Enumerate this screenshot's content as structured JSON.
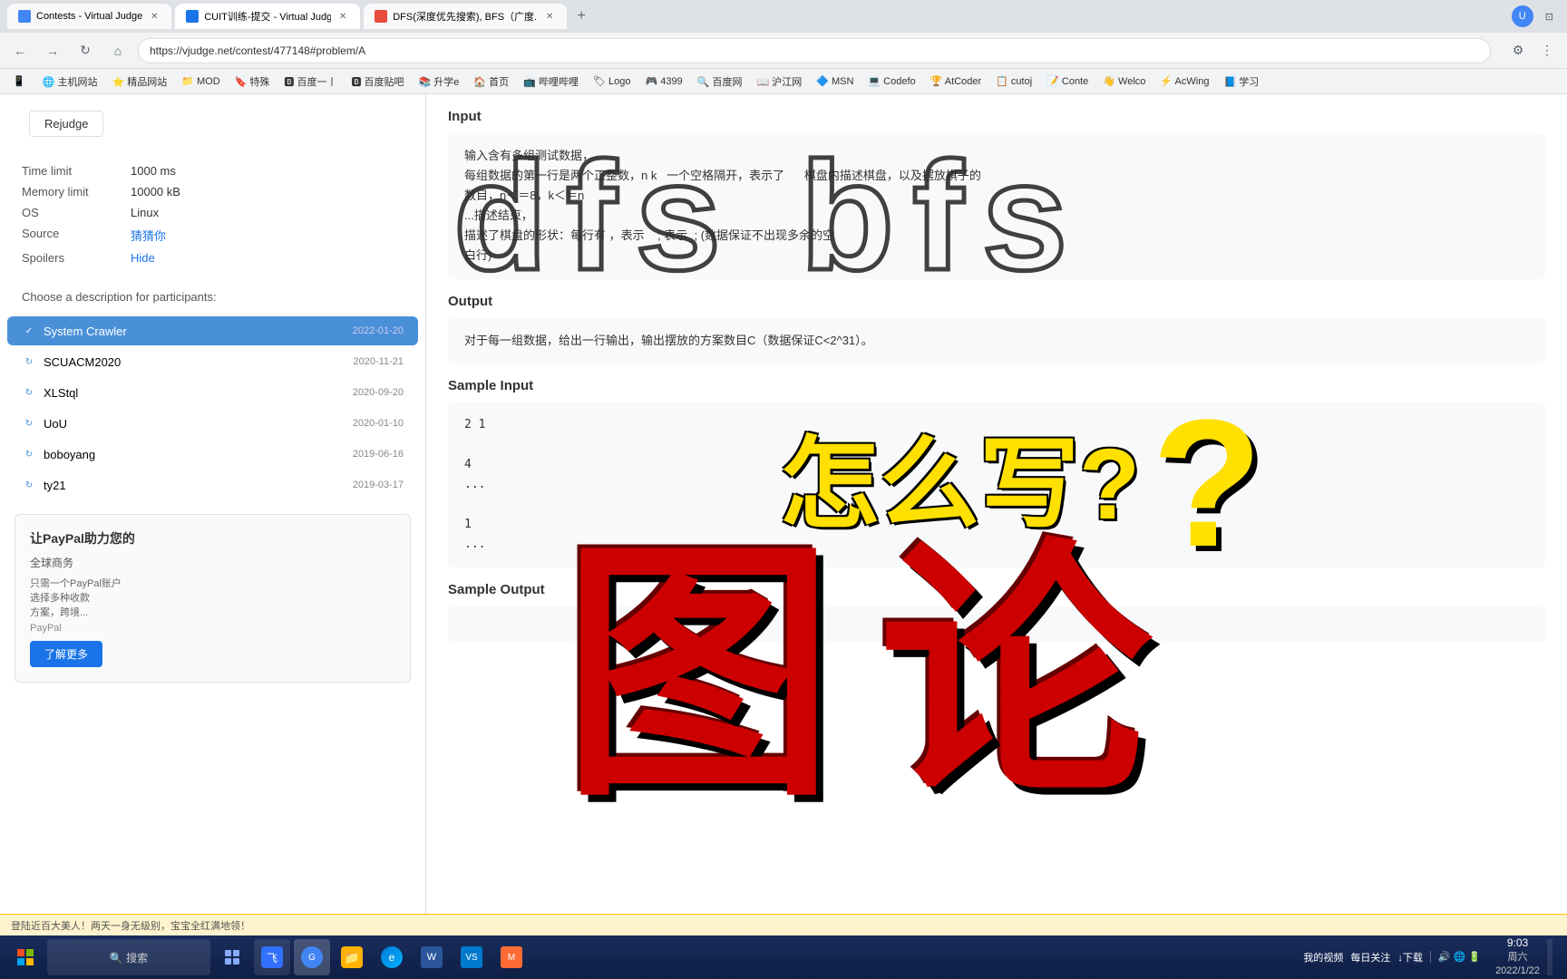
{
  "browser": {
    "tabs": [
      {
        "id": "tab1",
        "label": "Contests - Virtual Judge",
        "favicon_color": "#4285f4",
        "active": false
      },
      {
        "id": "tab2",
        "label": "CUIT训练-提交 - Virtual Judge",
        "favicon_color": "#1a73e8",
        "active": true
      },
      {
        "id": "tab3",
        "label": "DFS(深度优先搜索), BFS（广度...",
        "favicon_color": "#e74c3c",
        "active": false
      }
    ],
    "address": "https://vjudge.net/contest/477148#problem/A",
    "nav_buttons": [
      "←",
      "→",
      "↻",
      "⌂"
    ]
  },
  "bookmarks": [
    "手机收藏夹",
    "主机网站",
    "精品网站",
    "MOD",
    "特殊",
    "百度一丨",
    "百度贴吧",
    "升学e",
    "首页",
    "哔哩哔哩",
    "Logo",
    "4399",
    "百度网",
    "沪江网",
    "MSN",
    "Codefo",
    "AtCoder",
    "cutoj",
    "Conte",
    "Welco",
    "AcWing",
    "学习"
  ],
  "sidebar": {
    "rejudge_btn": "Rejudge",
    "problem_meta": {
      "time_limit_label": "Time limit",
      "time_limit_value": "1000 ms",
      "memory_limit_label": "Memory limit",
      "memory_limit_value": "10000 kB",
      "os_label": "OS",
      "os_value": "Linux",
      "source_label": "Source",
      "source_value": "猜猜你",
      "spoilers_label": "Spoilers",
      "spoilers_value": "Hide"
    },
    "choose_desc": "Choose a description for participants:",
    "sources": [
      {
        "name": "System Crawler",
        "date": "2022-01-20",
        "active": true
      },
      {
        "name": "SCUACM2020",
        "date": "2020-11-21",
        "active": false
      },
      {
        "name": "XLStql",
        "date": "2020-09-20",
        "active": false
      },
      {
        "name": "UoU",
        "date": "2020-01-10",
        "active": false
      },
      {
        "name": "boboyang",
        "date": "2019-06-16",
        "active": false
      },
      {
        "name": "ty21",
        "date": "2019-03-17",
        "active": false
      }
    ],
    "ad": {
      "title": "让PayPal助力您的",
      "subtitle": "全球商",
      "body": "只需一个Pa...\n选择多种...\n方案，跨境...",
      "source": "PayPal",
      "btn_label": "了解更多"
    }
  },
  "main": {
    "input_section": {
      "title": "Input",
      "content": "输入含有多组测试数据，\n每组数据的第一行是两个正整数，n k 一个空格隔开，表示了棋盘内描述棋盘，以及摆放棋子的\n数目，n＜＝8，k＜＝n\n...描述结束，\n描述了棋盘的形状：每行有  ，表示  (数据保证不出现多余的空\n白行)"
    },
    "output_section": {
      "title": "Output",
      "content": "对于每一组数据，给出一行输出，输出摆放的方案数目C（数据保证C<2^31）。"
    },
    "sample_input_section": {
      "title": "Sample Input",
      "content": "2 1\n\n4\n...\n\n1\n...\n"
    },
    "sample_output_section": {
      "title": "Sample Output",
      "content": ""
    }
  },
  "overlay": {
    "dfs_bfs": "dfs  bfs",
    "howto": "怎么写?",
    "tu": "图",
    "lun": "论"
  },
  "notif_bar": {
    "text": "登陆近百大美人！两天一身无级别，宝宝全红满地领！"
  },
  "taskbar": {
    "clock_time": "9:03",
    "clock_day": "周六",
    "clock_date": "2022/1/22",
    "right_items": [
      "我的视频",
      "每日关注",
      "下载"
    ]
  },
  "status_bar": {
    "text": "登陆近百大美人！两天一身无级别，宝宝全红满地领！",
    "right": "9:03 周六 2022/1/22"
  }
}
